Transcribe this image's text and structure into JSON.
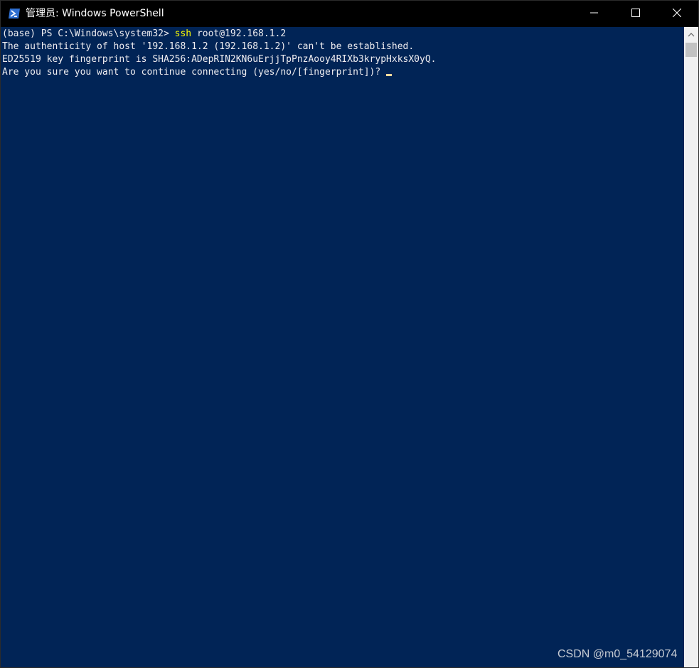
{
  "window": {
    "title": "管理员: Windows PowerShell",
    "icon": "powershell-icon"
  },
  "controls": {
    "minimize_icon": "minimize-icon",
    "maximize_icon": "maximize-icon",
    "close_icon": "close-icon"
  },
  "console": {
    "prompt": "(base) PS C:\\Windows\\system32> ",
    "command": "ssh",
    "command_args": " root@192.168.1.2",
    "lines": [
      "The authenticity of host '192.168.1.2 (192.168.1.2)' can't be established.",
      "ED25519 key fingerprint is SHA256:ADepRIN2KN6uErjjTpPnzAooy4RIXb3krypHxksX0yQ.",
      "Are you sure you want to continue connecting (yes/no/[fingerprint])? "
    ]
  },
  "watermark": "CSDN @m0_54129074",
  "colors": {
    "console_bg": "#012456",
    "text": "#eeedf0",
    "command": "#ffff00",
    "cursor": "#ffdc9c",
    "titlebar_bg": "#000000"
  }
}
